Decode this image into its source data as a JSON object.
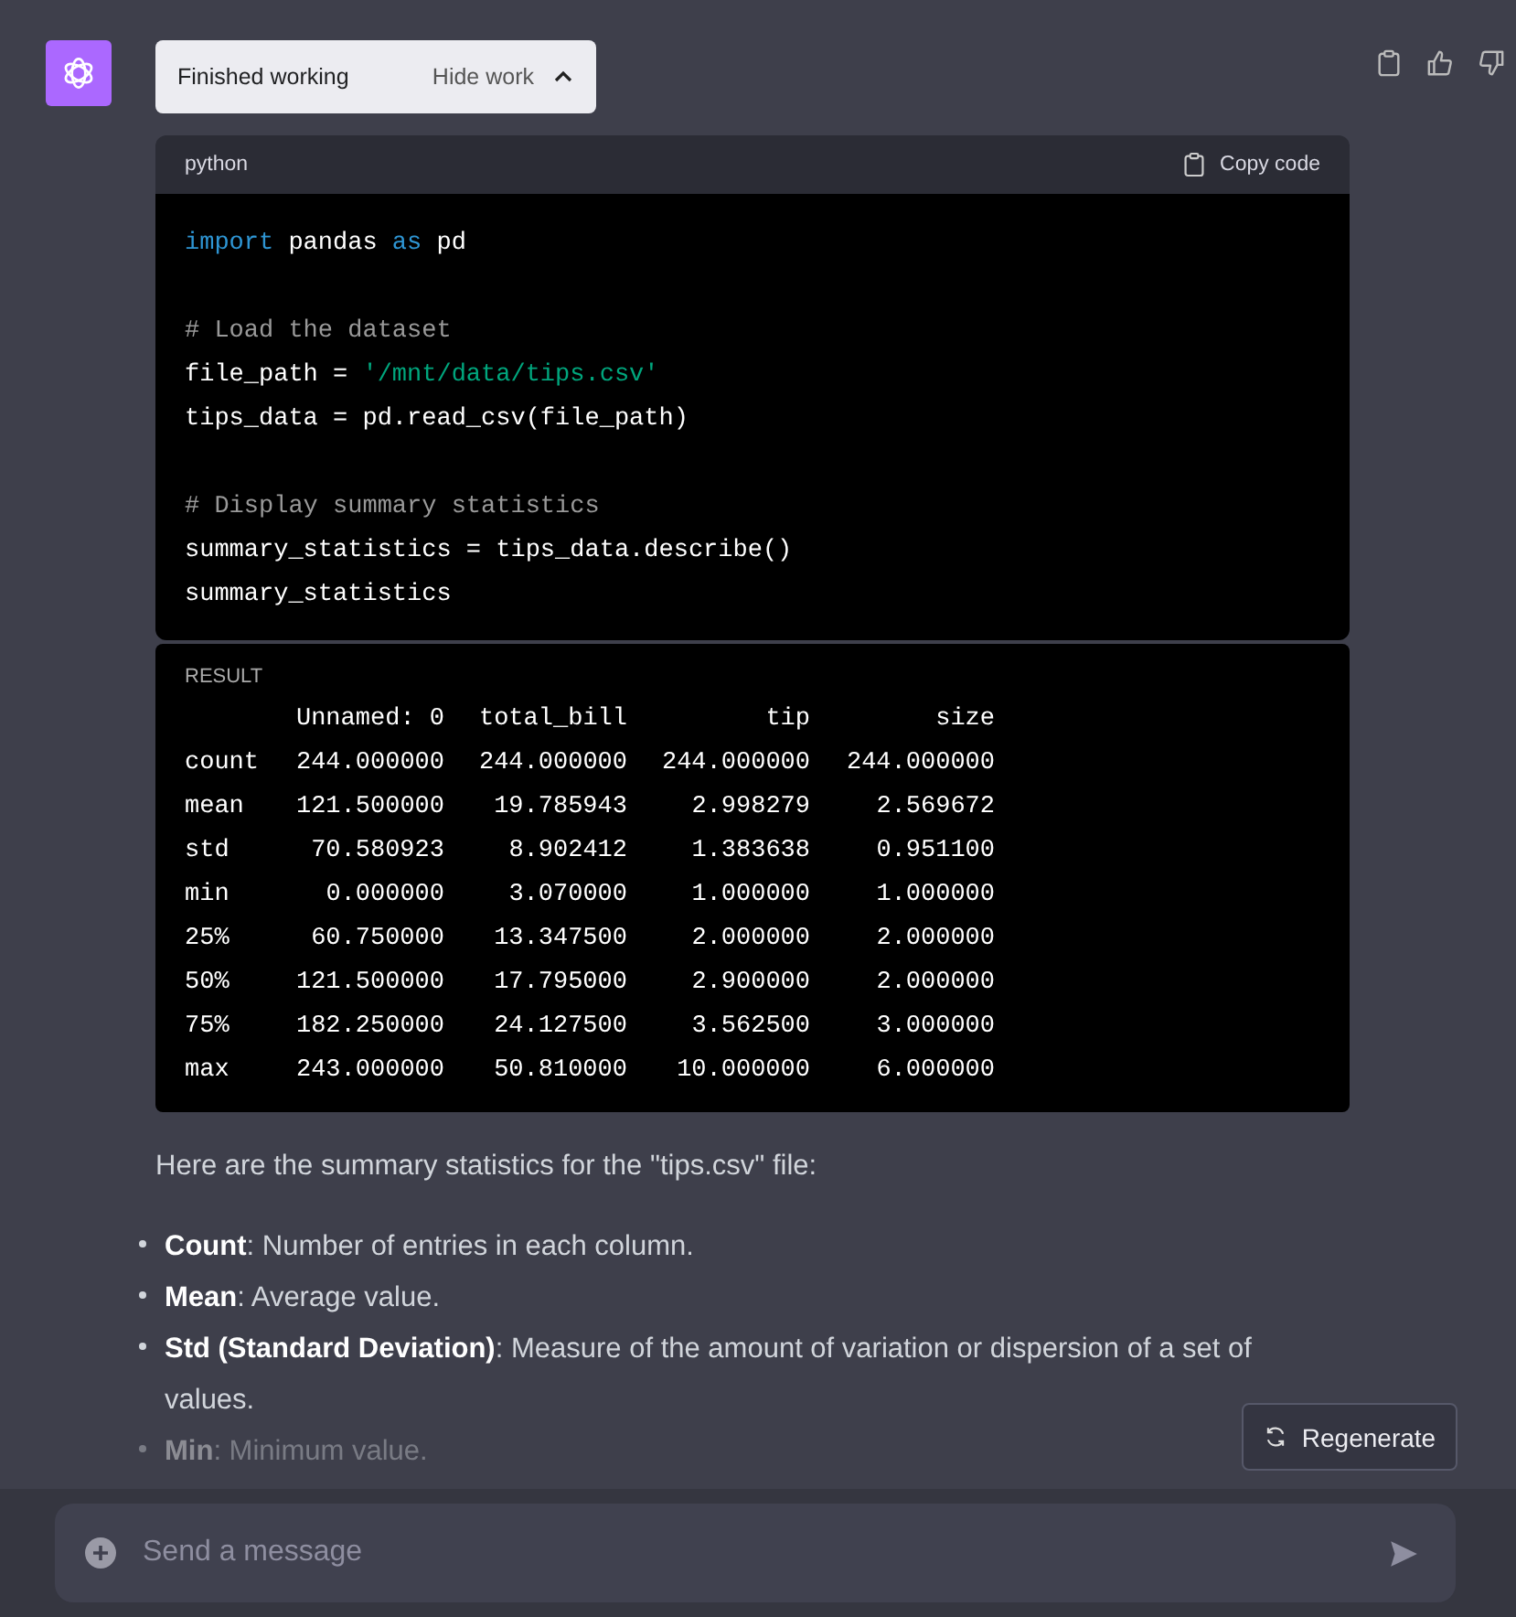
{
  "status": {
    "label": "Finished working",
    "toggle": "Hide work",
    "expanded": true
  },
  "code_block": {
    "language": "python",
    "copy_label": "Copy code",
    "lines": [
      {
        "kind": "code",
        "tokens": [
          {
            "kind": "keyword",
            "text": "import"
          },
          {
            "kind": "plain",
            "text": " pandas "
          },
          {
            "kind": "keyword",
            "text": "as"
          },
          {
            "kind": "plain",
            "text": " pd"
          }
        ]
      },
      {
        "kind": "blank"
      },
      {
        "kind": "code",
        "tokens": [
          {
            "kind": "comment",
            "text": "# Load the dataset"
          }
        ]
      },
      {
        "kind": "code",
        "tokens": [
          {
            "kind": "plain",
            "text": "file_path = "
          },
          {
            "kind": "string",
            "text": "'/mnt/data/tips.csv'"
          }
        ]
      },
      {
        "kind": "code",
        "tokens": [
          {
            "kind": "plain",
            "text": "tips_data = pd.read_csv(file_path)"
          }
        ]
      },
      {
        "kind": "blank"
      },
      {
        "kind": "code",
        "tokens": [
          {
            "kind": "comment",
            "text": "# Display summary statistics"
          }
        ]
      },
      {
        "kind": "code",
        "tokens": [
          {
            "kind": "plain",
            "text": "summary_statistics = tips_data.describe()"
          }
        ]
      },
      {
        "kind": "code",
        "tokens": [
          {
            "kind": "plain",
            "text": "summary_statistics"
          }
        ]
      }
    ]
  },
  "result": {
    "label": "RESULT",
    "columns": [
      "Unnamed: 0",
      "total_bill",
      "tip",
      "size"
    ],
    "rows": [
      {
        "label": "count",
        "values": [
          "244.000000",
          "244.000000",
          "244.000000",
          "244.000000"
        ]
      },
      {
        "label": "mean",
        "values": [
          "121.500000",
          "19.785943",
          "2.998279",
          "2.569672"
        ]
      },
      {
        "label": "std",
        "values": [
          "70.580923",
          "8.902412",
          "1.383638",
          "0.951100"
        ]
      },
      {
        "label": "min",
        "values": [
          "0.000000",
          "3.070000",
          "1.000000",
          "1.000000"
        ]
      },
      {
        "label": "25%",
        "values": [
          "60.750000",
          "13.347500",
          "2.000000",
          "2.000000"
        ]
      },
      {
        "label": "50%",
        "values": [
          "121.500000",
          "17.795000",
          "2.900000",
          "2.000000"
        ]
      },
      {
        "label": "75%",
        "values": [
          "182.250000",
          "24.127500",
          "3.562500",
          "3.000000"
        ]
      },
      {
        "label": "max",
        "values": [
          "243.000000",
          "50.810000",
          "10.000000",
          "6.000000"
        ]
      }
    ]
  },
  "intro": "Here are the summary statistics for the \"tips.csv\" file:",
  "bullets": [
    {
      "text": "**Count**: Number of entries in each column.",
      "faded": false
    },
    {
      "text": "**Mean**: Average value.",
      "faded": false
    },
    {
      "text": "**Std (Standard Deviation)**: Measure of the amount of variation or dispersion of a set of values.",
      "faded": false
    },
    {
      "text": "**Min**: Minimum value.",
      "faded": true
    }
  ],
  "regenerate": "Regenerate",
  "composer": {
    "placeholder": "Send a message"
  }
}
